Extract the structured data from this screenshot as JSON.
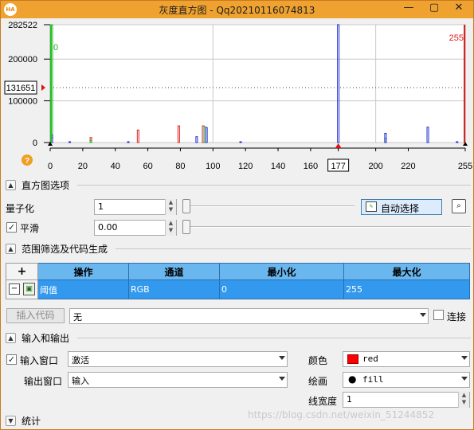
{
  "window": {
    "title": "灰度直方图 - Qq20210116074813",
    "minimize": "—",
    "maximize": "▢",
    "close": "✕"
  },
  "chart_data": {
    "type": "bar",
    "title": "",
    "xlabel": "",
    "ylabel": "",
    "xlim": [
      0,
      255
    ],
    "ylim": [
      0,
      282522
    ],
    "x_ticks": [
      0,
      20,
      40,
      60,
      80,
      100,
      120,
      140,
      160,
      177,
      200,
      220,
      255
    ],
    "y_ticks": [
      0,
      100000,
      200000,
      282522
    ],
    "y_tick_labels": [
      "0",
      "100000",
      "200000",
      "282522"
    ],
    "threshold_label": "131651",
    "threshold_value": 131651,
    "lower_threshold_label": "0",
    "upper_threshold_label": "255",
    "cursor_x": 177,
    "grid": true,
    "series": [
      {
        "color": "#e02020",
        "points": [
          [
            25,
            12000
          ],
          [
            54,
            30000
          ],
          [
            79,
            40000
          ],
          [
            94,
            40000
          ],
          [
            1,
            12000
          ]
        ]
      },
      {
        "color": "#20b020",
        "points": [
          [
            1,
            282522
          ],
          [
            95,
            38000
          ],
          [
            206,
            10000
          ],
          [
            25,
            5000
          ]
        ]
      },
      {
        "color": "#2030d0",
        "points": [
          [
            1,
            18000
          ],
          [
            12,
            2000
          ],
          [
            48,
            2000
          ],
          [
            90,
            14000
          ],
          [
            96,
            36000
          ],
          [
            117,
            2000
          ],
          [
            177,
            282522
          ],
          [
            206,
            22000
          ],
          [
            232,
            37000
          ],
          [
            250,
            2000
          ]
        ]
      }
    ]
  },
  "histogram_options": {
    "section_label": "直方图选项",
    "quantize_label": "量子化",
    "quantize_value": "1",
    "smooth_label": "平滑",
    "smooth_checked": "✓",
    "smooth_value": "0.00",
    "auto_select_label": "自动选择",
    "help_glyph": "?"
  },
  "range_filter": {
    "section_label": "范围筛选及代码生成",
    "table": {
      "add_glyph": "+",
      "headers": [
        "操作",
        "通道",
        "最小化",
        "最大化"
      ],
      "rows": [
        {
          "remove_glyph": "−",
          "op": "阈值",
          "channel": "RGB",
          "min": "0",
          "max": "255"
        }
      ]
    },
    "insert_code_label": "插入代码",
    "code_select_value": "无",
    "connect_label": "连接"
  },
  "io": {
    "section_label": "输入和输出",
    "input_window_label": "输入窗口",
    "input_window_checked": "✓",
    "input_window_value": "激活",
    "output_window_label": "输出窗口",
    "output_window_value": "输入",
    "color_label": "颜色",
    "color_value": "red",
    "color_swatch": "#ff0000",
    "draw_label": "绘画",
    "draw_value": "fill",
    "line_width_label": "线宽度",
    "line_width_value": "1"
  },
  "stats": {
    "section_label": "统计"
  },
  "watermark": "https://blog.csdn.net/weixin_51244852"
}
